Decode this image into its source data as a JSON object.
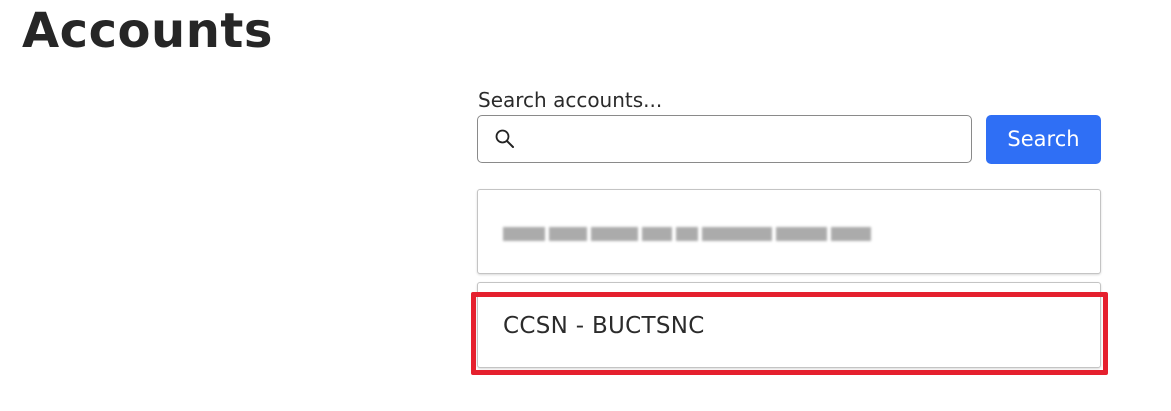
{
  "page": {
    "title": "Accounts"
  },
  "search": {
    "label": "Search accounts...",
    "value": "",
    "placeholder": "",
    "button_label": "Search",
    "icon": "search-icon"
  },
  "results": [
    {
      "label": "",
      "redacted": true
    },
    {
      "label": "CCSN - BUCTSNC",
      "redacted": false
    }
  ],
  "colors": {
    "accent": "#2f6ff5",
    "highlight": "#e5202e",
    "title": "#262626"
  }
}
